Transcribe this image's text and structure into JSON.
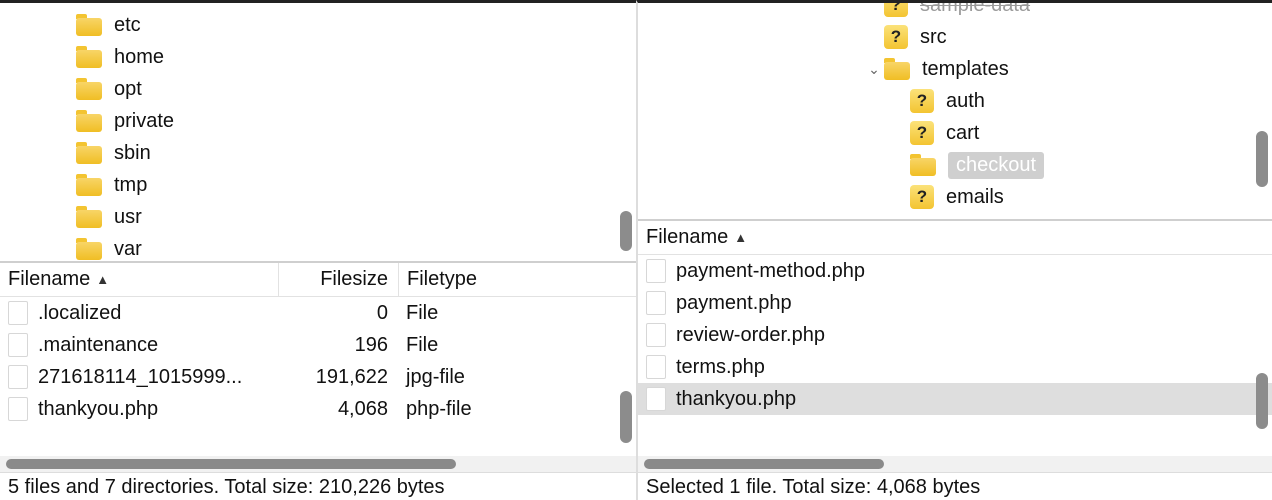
{
  "left": {
    "tree": [
      {
        "name": "etc",
        "kind": "folder"
      },
      {
        "name": "home",
        "kind": "folder"
      },
      {
        "name": "opt",
        "kind": "folder"
      },
      {
        "name": "private",
        "kind": "folder"
      },
      {
        "name": "sbin",
        "kind": "folder"
      },
      {
        "name": "tmp",
        "kind": "folder"
      },
      {
        "name": "usr",
        "kind": "folder"
      },
      {
        "name": "var",
        "kind": "folder"
      }
    ],
    "columns": {
      "name": "Filename",
      "size": "Filesize",
      "type": "Filetype"
    },
    "files": [
      {
        "name": ".localized",
        "size": "0",
        "type": "File"
      },
      {
        "name": ".maintenance",
        "size": "196",
        "type": "File"
      },
      {
        "name": "271618114_1015999...",
        "size": "191,622",
        "type": "jpg-file"
      },
      {
        "name": "thankyou.php",
        "size": "4,068",
        "type": "php-file"
      }
    ],
    "status": "5 files and 7 directories. Total size: 210,226 bytes"
  },
  "right": {
    "tree": [
      {
        "name": "sample-data",
        "kind": "unknown",
        "indent": 0,
        "disclosure": "",
        "cutoff": true
      },
      {
        "name": "src",
        "kind": "unknown",
        "indent": 0,
        "disclosure": ""
      },
      {
        "name": "templates",
        "kind": "folder",
        "indent": 0,
        "disclosure": "v"
      },
      {
        "name": "auth",
        "kind": "unknown",
        "indent": 1,
        "disclosure": ""
      },
      {
        "name": "cart",
        "kind": "unknown",
        "indent": 1,
        "disclosure": ""
      },
      {
        "name": "checkout",
        "kind": "folder",
        "indent": 1,
        "disclosure": "",
        "selected": true
      },
      {
        "name": "emails",
        "kind": "unknown",
        "indent": 1,
        "disclosure": ""
      }
    ],
    "columns": {
      "name": "Filename"
    },
    "files": [
      {
        "name": "payment-method.php"
      },
      {
        "name": "payment.php"
      },
      {
        "name": "review-order.php"
      },
      {
        "name": "terms.php"
      },
      {
        "name": "thankyou.php",
        "selected": true
      }
    ],
    "status": "Selected 1 file. Total size: 4,068 bytes"
  }
}
